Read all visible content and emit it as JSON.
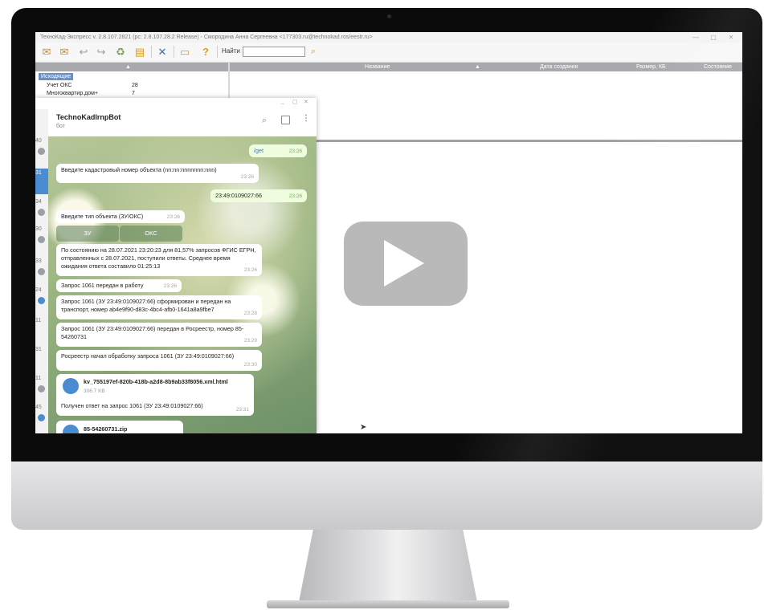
{
  "app": {
    "title_bar": "ТехноКад-Экспресс v. 2.8.107.2821 (pc: 2.8.107.28.2 Release) - Смородина Анна Сергеевна <177303.ru@technokad.ros/eestr.ru>",
    "window_controls": [
      "—",
      "▢",
      "✕"
    ]
  },
  "toolbar": {
    "icons": [
      "inbox-icon",
      "outbox-icon",
      "mail-reply-icon",
      "mail-forward-icon",
      "recycle-icon",
      "folder-icon",
      "tools-icon",
      "chat-icon",
      "help-icon"
    ],
    "find_label": "Найти",
    "find_value": "",
    "find_icon": "search-icon"
  },
  "tree": {
    "header_arrow": "▲",
    "root": "Исходящие",
    "items": [
      {
        "label": "Учет ОКС",
        "count": "28"
      },
      {
        "label": "Многоквартир.дом+",
        "count": "7"
      }
    ]
  },
  "table": {
    "columns": [
      "Название",
      "▲",
      "Дата создания",
      "Размер, КБ",
      "Состояние"
    ]
  },
  "telegram": {
    "window_controls": [
      "_",
      "▢",
      "✕"
    ],
    "bot_name": "TechnoKadIrnpBot",
    "bot_status": "бот",
    "sidebar_numbers": [
      "40",
      "31",
      "34",
      "30",
      "33",
      "24",
      "11",
      "31",
      "11",
      "45"
    ],
    "messages": [
      {
        "text": "/get",
        "time": "23:26",
        "out": true
      },
      {
        "text": "Введите кадастровый номер объекта (nn:nn:nnnnnnn:nnn)",
        "time": "23:26",
        "out": false
      },
      {
        "text": "23:49:0109027:66",
        "time": "23:26",
        "out": true
      },
      {
        "text": "Введите тип объекта (ЗУ/ОКС)",
        "time": "23:26",
        "out": false
      },
      {
        "text": "По состоянию на 28.07.2021 23:20:23 для 81,57% запросов ФГИС ЕГРН, отправленных с 28.07.2021, поступили ответы. Среднее время ожидания ответа составило 01:25:13",
        "time": "23:26",
        "out": false
      },
      {
        "text": "Запрос 1061 передан в работу",
        "time": "23:26",
        "out": false
      },
      {
        "text": "Запрос 1061 (ЗУ 23:49:0109027:66) сформирован и передан на транспорт, номер ab4e9f90-d83c-4bc4-afb0-1641a8a9fbe7",
        "time": "23:28",
        "out": false
      },
      {
        "text": "Запрос 1061 (ЗУ 23:49:0109027:66) передан в Росреестр, номер 85-54260731",
        "time": "23:29",
        "out": false
      },
      {
        "text": "Росреестр начал обработку запроса 1061 (ЗУ 23:49:0109027:66)",
        "time": "23:30",
        "out": false
      }
    ],
    "keyboard": [
      "ЗУ",
      "ОКС"
    ],
    "file1": {
      "name": "kv_755197ef-820b-418b-a2d8-8b9ab33f8056.xml.html",
      "size": "306.7 KB",
      "caption": "Получен ответ на запрос 1061 (ЗУ 23:49:0109027:66)",
      "time": "23:31"
    },
    "file2": {
      "name": "85-54260731.zip"
    }
  },
  "overlay": {
    "play_icon": "play-button-icon"
  }
}
